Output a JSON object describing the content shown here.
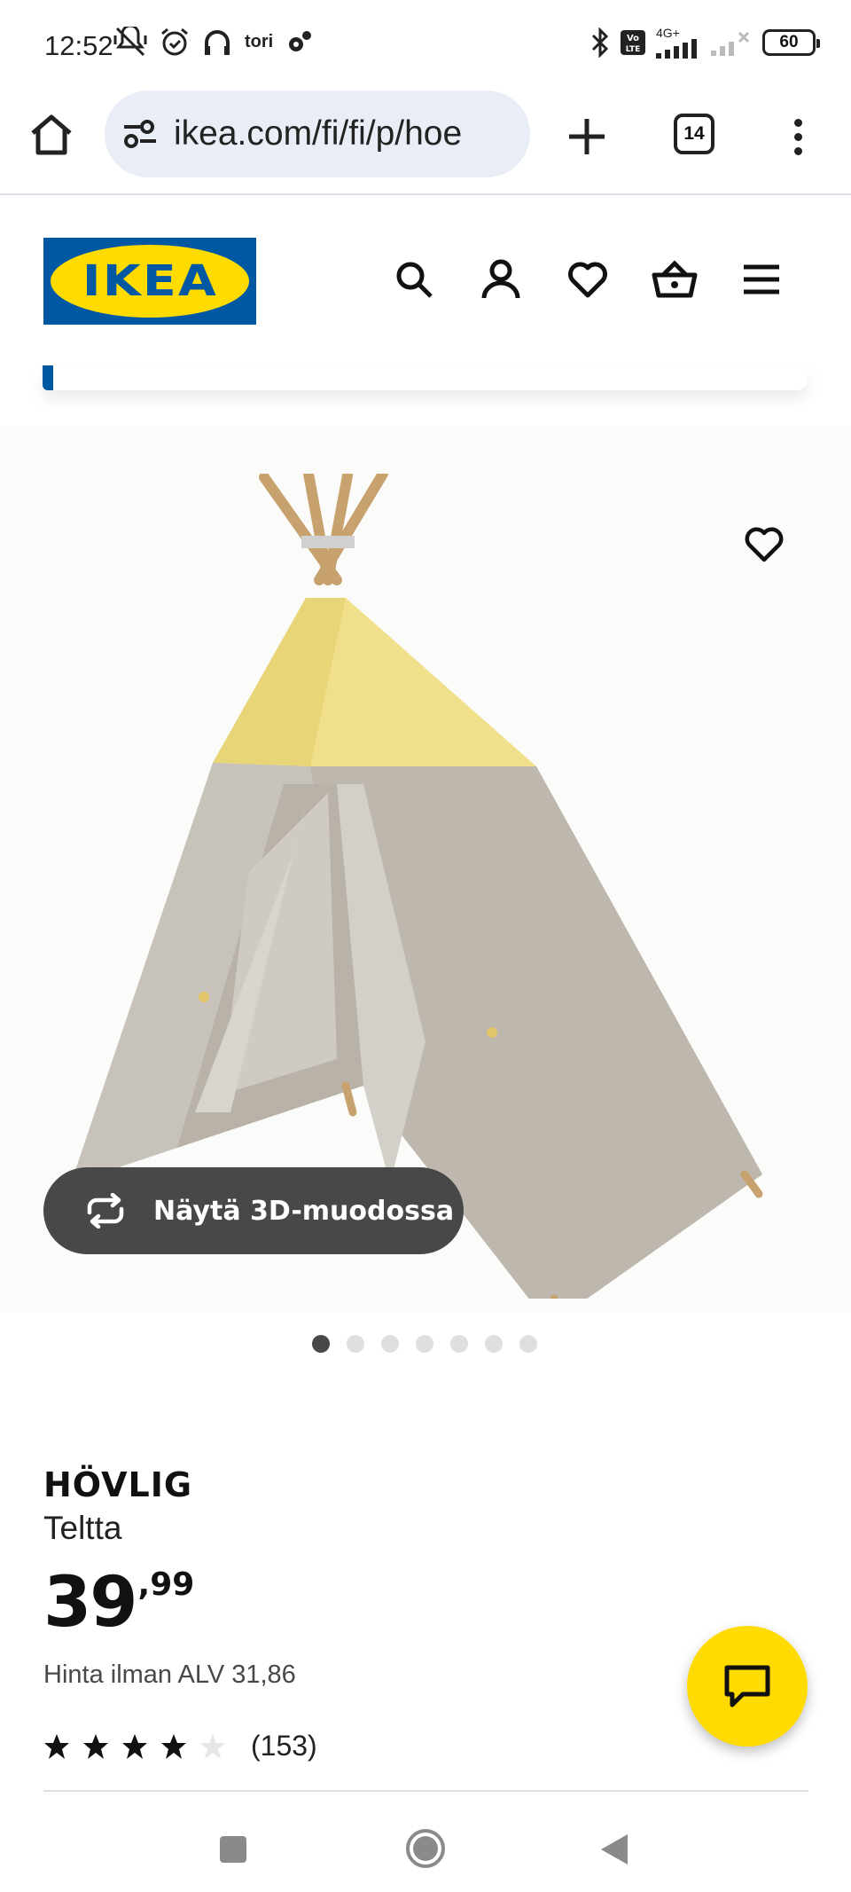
{
  "status_bar": {
    "time": "12:52",
    "left_icons": [
      "mute-vibrate-icon",
      "alarm-icon",
      "headphones-icon",
      "tori-app-icon",
      "settings-cog-icon"
    ],
    "tori_label": "tori",
    "network_label": "4G+",
    "volte_label": "Vo LTE",
    "battery": "60"
  },
  "browser": {
    "url": "ikea.com/fi/fi/p/hoe",
    "tab_count": "14"
  },
  "site": {
    "logo_text": "IKEA",
    "header_icons": [
      "search-icon",
      "account-icon",
      "favourites-icon",
      "basket-icon",
      "menu-icon"
    ]
  },
  "gallery": {
    "view_3d_label": "Näytä 3D-muodossa",
    "dots_total": 7,
    "active_dot": 1
  },
  "product": {
    "name": "HÖVLIG",
    "type": "Teltta",
    "price_integer": "39",
    "price_decimal": ",99",
    "price_without_vat": "Hinta ilman ALV 31,86",
    "rating_stars": 4,
    "rating_max": 5,
    "review_count": "(153)"
  },
  "colors": {
    "ikea_blue": "#0058a3",
    "ikea_yellow": "#ffdb00",
    "dark_button": "#484848"
  }
}
